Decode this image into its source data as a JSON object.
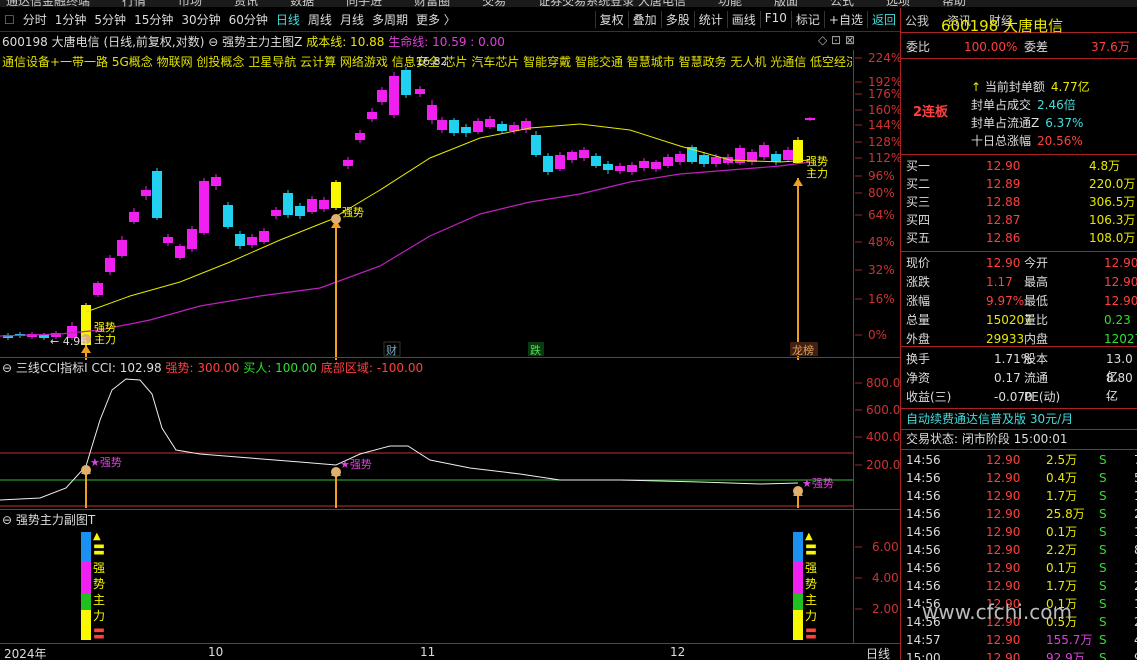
{
  "top_menu": [
    "通达信金融终端",
    "行情",
    "市场",
    "资讯",
    "数据",
    "同手进",
    "财富圈",
    "交易",
    "证券交易系统登录  大唐电信",
    "功能",
    "版面",
    "公式",
    "选项",
    "帮助"
  ],
  "toolbar_left": [
    "分时",
    "1分钟",
    "5分钟",
    "15分钟",
    "30分钟",
    "60分钟",
    "日线",
    "周线",
    "月线",
    "多周期",
    "更多 〉"
  ],
  "toolbar_right": [
    "复权",
    "叠加",
    "多股",
    "统计",
    "画线",
    "F10",
    "标记",
    "+自选",
    "返回"
  ],
  "right_tabs": [
    "公我",
    "资讯",
    "财经"
  ],
  "chart_header": {
    "stock": "600198 大唐电信 (日线,前复权,对数)",
    "indicator": "强势主力主图Z",
    "cost_label": "成本线: 10.88",
    "life_label": "生命线: 10.59 : 0.00"
  },
  "concepts": "通信设备+一带一路 5G概念 物联网 创投概念 卫星导航 云计算 网络游戏 信息安全 芯片 汽车芯片 智能穿戴 智能交通 智慧城市 智慧政务 无人机 光通信 低空经济",
  "main_labels": {
    "qiangshi": "强势",
    "zhuli": "主力",
    "low_mark": "← 4.96",
    "high_mark": "16.82",
    "cai": "财",
    "die": "跌",
    "long": "龙榜"
  },
  "main_axis": [
    "224%",
    "192%",
    "176%",
    "160%",
    "144%",
    "128%",
    "112%",
    "96%",
    "80%",
    "64%",
    "48%",
    "32%",
    "16%",
    "0%"
  ],
  "cci_header": {
    "name": "三线CCI指标I",
    "cci": "CCI: 102.98",
    "qs": "强势: 300.00",
    "mr": "买人: 100.00",
    "dd": "底部区域: -100.00"
  },
  "cci_axis": [
    "800.0",
    "600.0",
    "400.0",
    "200.0"
  ],
  "cci_mark": "★强势",
  "sub_header": "强势主力副图T",
  "sub_axis": [
    "6.00",
    "4.00",
    "2.00"
  ],
  "sub_chars": [
    "强",
    "势",
    "主",
    "力"
  ],
  "x_axis": [
    "2024年",
    "10",
    "11",
    "12",
    "日线"
  ],
  "rp": {
    "code_title": "600198 大唐电信",
    "wb_label": "委比",
    "wb_value": "100.00%",
    "wc_label": "委差",
    "wc_value": "37.6万",
    "lianban": "2连板",
    "seal": [
      {
        "label": "当前封单额",
        "value": "4.77亿"
      },
      {
        "label": "封单占成交",
        "value": "2.46倍"
      },
      {
        "label": "封单占流通Z",
        "value": "6.37%"
      },
      {
        "label": "十日总涨幅",
        "value": "20.56%"
      }
    ],
    "buys": [
      {
        "label": "买一",
        "price": "12.90",
        "vol": "4.8万"
      },
      {
        "label": "买二",
        "price": "12.89",
        "vol": "220.0万"
      },
      {
        "label": "买三",
        "price": "12.88",
        "vol": "306.5万"
      },
      {
        "label": "买四",
        "price": "12.87",
        "vol": "106.3万"
      },
      {
        "label": "买五",
        "price": "12.86",
        "vol": "108.0万"
      }
    ],
    "quote": [
      {
        "l1": "现价",
        "v1": "12.90",
        "l2": "今开",
        "v2": "12.90"
      },
      {
        "l1": "涨跌",
        "v1": "1.17",
        "l2": "最高",
        "v2": "12.90"
      },
      {
        "l1": "涨幅",
        "v1": "9.97%",
        "l2": "最低",
        "v2": "12.90"
      },
      {
        "l1": "总量",
        "v1": "150207",
        "l2": "量比",
        "v2": "0.23"
      },
      {
        "l1": "外盘",
        "v1": "29933",
        "l2": "内盘",
        "v2": "120274"
      }
    ],
    "fin": [
      {
        "l1": "换手",
        "v1": "1.71%",
        "l2": "股本",
        "v2": "13.0亿"
      },
      {
        "l1": "净资",
        "v1": "0.17",
        "l2": "流通",
        "v2": "8.80亿"
      },
      {
        "l1": "收益(三)",
        "v1": "-0.070",
        "l2": "PE(动)",
        "v2": "--"
      }
    ],
    "ad": "自动续费通达信普及版  30元/月",
    "status": "交易状态: 闭市阶段 15:00:01",
    "ticks": [
      {
        "t": "14:56",
        "p": "12.90",
        "v": "2.5万",
        "s": "S",
        "n": "7"
      },
      {
        "t": "14:56",
        "p": "12.90",
        "v": "0.4万",
        "s": "S",
        "n": "5"
      },
      {
        "t": "14:56",
        "p": "12.90",
        "v": "1.7万",
        "s": "S",
        "n": "1"
      },
      {
        "t": "14:56",
        "p": "12.90",
        "v": "25.8万",
        "s": "S",
        "n": "2"
      },
      {
        "t": "14:56",
        "p": "12.90",
        "v": "0.1万",
        "s": "S",
        "n": "1"
      },
      {
        "t": "14:56",
        "p": "12.90",
        "v": "2.2万",
        "s": "S",
        "n": "8"
      },
      {
        "t": "14:56",
        "p": "12.90",
        "v": "0.1万",
        "s": "S",
        "n": "1"
      },
      {
        "t": "14:56",
        "p": "12.90",
        "v": "1.7万",
        "s": "S",
        "n": "2"
      },
      {
        "t": "14:56",
        "p": "12.90",
        "v": "0.1万",
        "s": "S",
        "n": "1"
      },
      {
        "t": "14:56",
        "p": "12.90",
        "v": "0.5万",
        "s": "S",
        "n": "2"
      },
      {
        "t": "14:57",
        "p": "12.90",
        "v": "155.7万",
        "s": "S",
        "n": "48"
      },
      {
        "t": "15:00",
        "p": "12.90",
        "v": "92.9万",
        "s": "S",
        "n": "9"
      }
    ]
  },
  "watermark": "www.cfchi.com"
}
